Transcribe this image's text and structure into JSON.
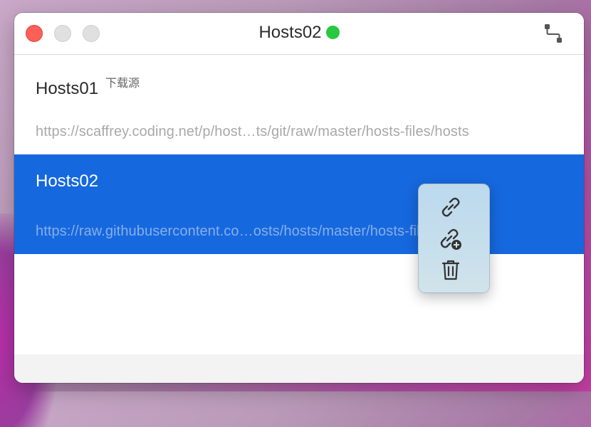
{
  "window": {
    "title": "Hosts02",
    "status": "online",
    "status_color": "#28c840"
  },
  "titlebar": {
    "close_icon": "close-icon",
    "minimize_icon": "minimize-icon",
    "zoom_icon": "zoom-icon",
    "right_icon": "topology-icon"
  },
  "hosts": [
    {
      "name": "Hosts01",
      "tag": "下载源",
      "url": "https://scaffrey.coding.net/p/host…ts/git/raw/master/hosts-files/hosts",
      "selected": false
    },
    {
      "name": "Hosts02",
      "tag": "",
      "url": "https://raw.githubusercontent.co…osts/hosts/master/hosts-files/hosts",
      "selected": true
    }
  ],
  "popover": {
    "items": [
      {
        "icon": "link-icon"
      },
      {
        "icon": "add-link-icon"
      },
      {
        "icon": "trash-icon"
      }
    ]
  },
  "colors": {
    "selection": "#1668de",
    "popover_bg": "#c5deed"
  }
}
